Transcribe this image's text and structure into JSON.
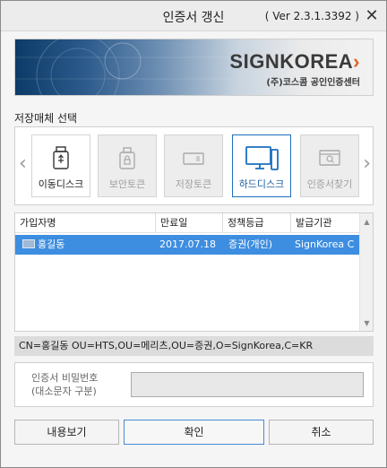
{
  "window": {
    "title": "인증서 갱신",
    "version": "( Ver 2.3.1.3392 )",
    "close_glyph": "✕"
  },
  "banner": {
    "brand_name": "SIGNKOREA",
    "brand_arrow": "›",
    "brand_sub": "(주)코스콤 공인인증센터"
  },
  "storage": {
    "label": "저장매체 선택",
    "prev_glyph": "‹",
    "next_glyph": "›",
    "items": [
      {
        "label": "이동디스크",
        "icon": "usb-drive-icon",
        "state": "enabled"
      },
      {
        "label": "보안토큰",
        "icon": "security-token-icon",
        "state": "disabled"
      },
      {
        "label": "저장토큰",
        "icon": "storage-token-icon",
        "state": "disabled"
      },
      {
        "label": "하드디스크",
        "icon": "hard-disk-icon",
        "state": "selected"
      },
      {
        "label": "인증서찾기",
        "icon": "cert-search-icon",
        "state": "disabled"
      }
    ]
  },
  "table": {
    "columns": [
      "가입자명",
      "만료일",
      "정책등급",
      "발급기관"
    ],
    "rows": [
      {
        "subscriber": "홍길동",
        "expiry": "2017.07.18",
        "policy": "증권(개인)",
        "issuer": "SignKorea C"
      }
    ],
    "scroll_up": "▲",
    "scroll_down": "▼"
  },
  "dn": "CN=홍길동 OU=HTS,OU=메리츠,OU=증권,O=SignKorea,C=KR",
  "password": {
    "label_line1": "인증서 비밀번호",
    "label_line2": "(대소문자 구분)",
    "value": ""
  },
  "buttons": {
    "view": "내용보기",
    "ok": "확인",
    "cancel": "취소"
  },
  "colors": {
    "selected_row": "#3d8ee0",
    "brand_accent": "#e0611d",
    "primary_border": "#4a8ad4"
  }
}
